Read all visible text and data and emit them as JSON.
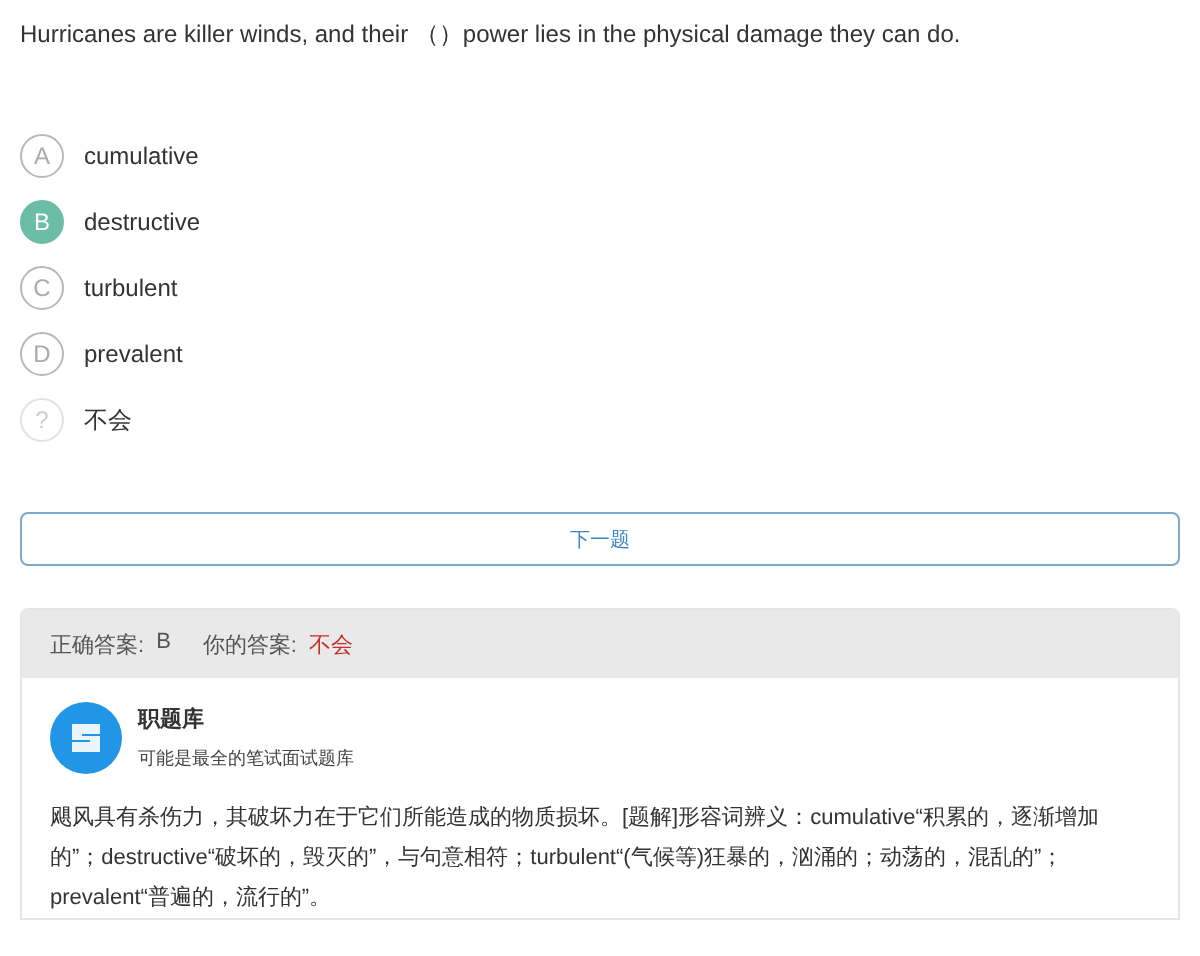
{
  "question": "Hurricanes are killer winds, and their （）power lies in the physical damage they can do.",
  "options": [
    {
      "kind": "letter",
      "letter": "A",
      "text": "cumulative",
      "selected": false
    },
    {
      "kind": "letter",
      "letter": "B",
      "text": "destructive",
      "selected": true
    },
    {
      "kind": "letter",
      "letter": "C",
      "text": "turbulent",
      "selected": false
    },
    {
      "kind": "letter",
      "letter": "D",
      "text": "prevalent",
      "selected": false
    },
    {
      "kind": "unknown",
      "letter": "?",
      "text": "不会",
      "selected": false
    }
  ],
  "next_button": "下一题",
  "answer_panel": {
    "correct_label": "正确答案:",
    "correct_value": "B",
    "yours_label": "你的答案:",
    "yours_value": "不会",
    "source": {
      "name": "职题库",
      "tagline": "可能是最全的笔试面试题库"
    },
    "explanation": "飓风具有杀伤力，其破坏力在于它们所能造成的物质损坏。[题解]形容词辨义：cumulative“积累的，逐渐增加的”；destructive“破坏的，毁灭的”，与句意相符；turbulent“(气候等)狂暴的，汹涌的；动荡的，混乱的”；prevalent“普遍的，流行的”。"
  }
}
